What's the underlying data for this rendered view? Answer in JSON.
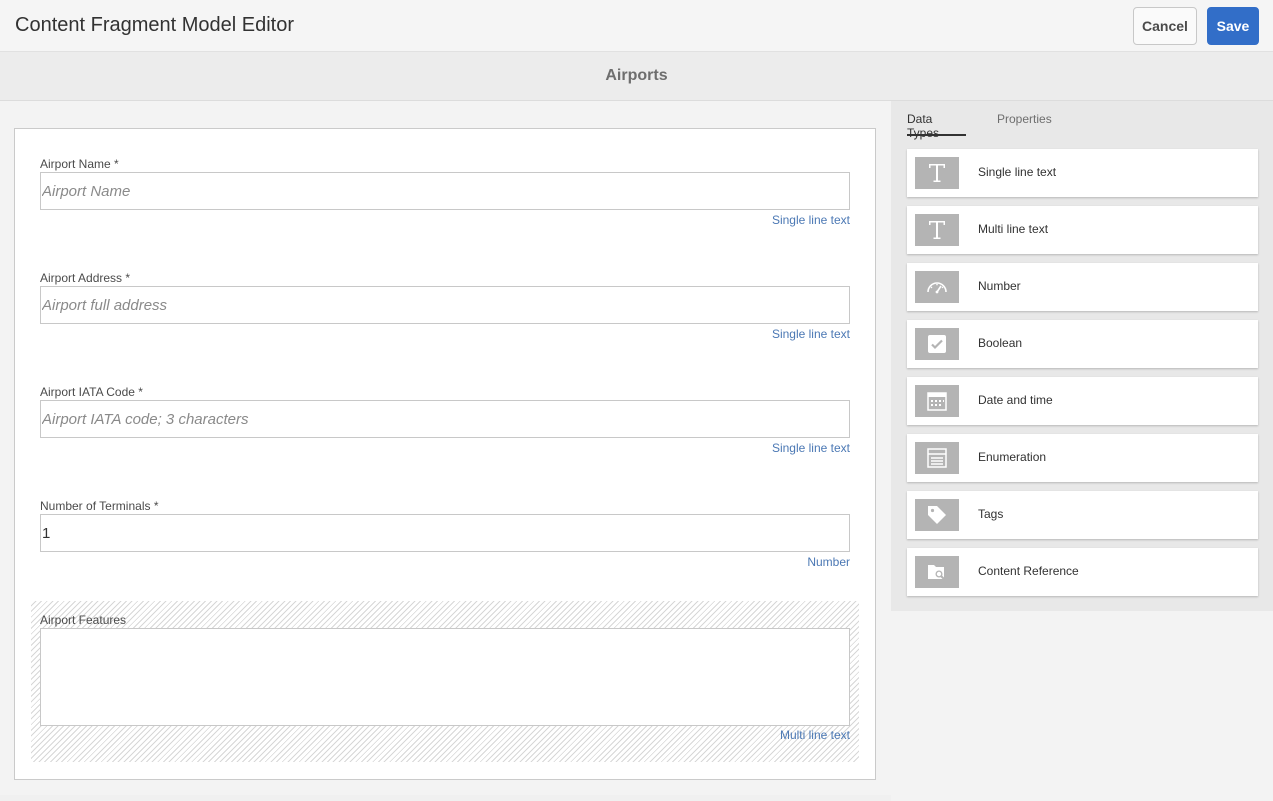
{
  "header": {
    "title": "Content Fragment Model Editor",
    "cancel_label": "Cancel",
    "save_label": "Save"
  },
  "model": {
    "title": "Airports"
  },
  "fields": [
    {
      "label": "Airport Name *",
      "placeholder": "Airport Name",
      "value": "",
      "type": "Single line text"
    },
    {
      "label": "Airport Address *",
      "placeholder": "Airport full address",
      "value": "",
      "type": "Single line text"
    },
    {
      "label": "Airport IATA Code *",
      "placeholder": "Airport IATA code; 3 characters",
      "value": "",
      "type": "Single line text"
    },
    {
      "label": "Number of Terminals *",
      "placeholder": "",
      "value": "1",
      "type": "Number"
    },
    {
      "label": "Airport Features",
      "placeholder": "",
      "value": "",
      "type": "Multi line text"
    }
  ],
  "panel": {
    "tabs": [
      {
        "label": "Data Types",
        "active": true
      },
      {
        "label": "Properties",
        "active": false
      }
    ],
    "data_types": [
      {
        "label": "Single line text",
        "icon": "text-t-icon"
      },
      {
        "label": "Multi line text",
        "icon": "text-t-icon"
      },
      {
        "label": "Number",
        "icon": "gauge-icon"
      },
      {
        "label": "Boolean",
        "icon": "checkbox-icon"
      },
      {
        "label": "Date and time",
        "icon": "calendar-icon"
      },
      {
        "label": "Enumeration",
        "icon": "list-icon"
      },
      {
        "label": "Tags",
        "icon": "tag-icon"
      },
      {
        "label": "Content Reference",
        "icon": "folder-search-icon"
      }
    ]
  },
  "colors": {
    "accent": "#326ec8",
    "link": "#4b78b4",
    "icon_bg": "#b4b4b4"
  }
}
